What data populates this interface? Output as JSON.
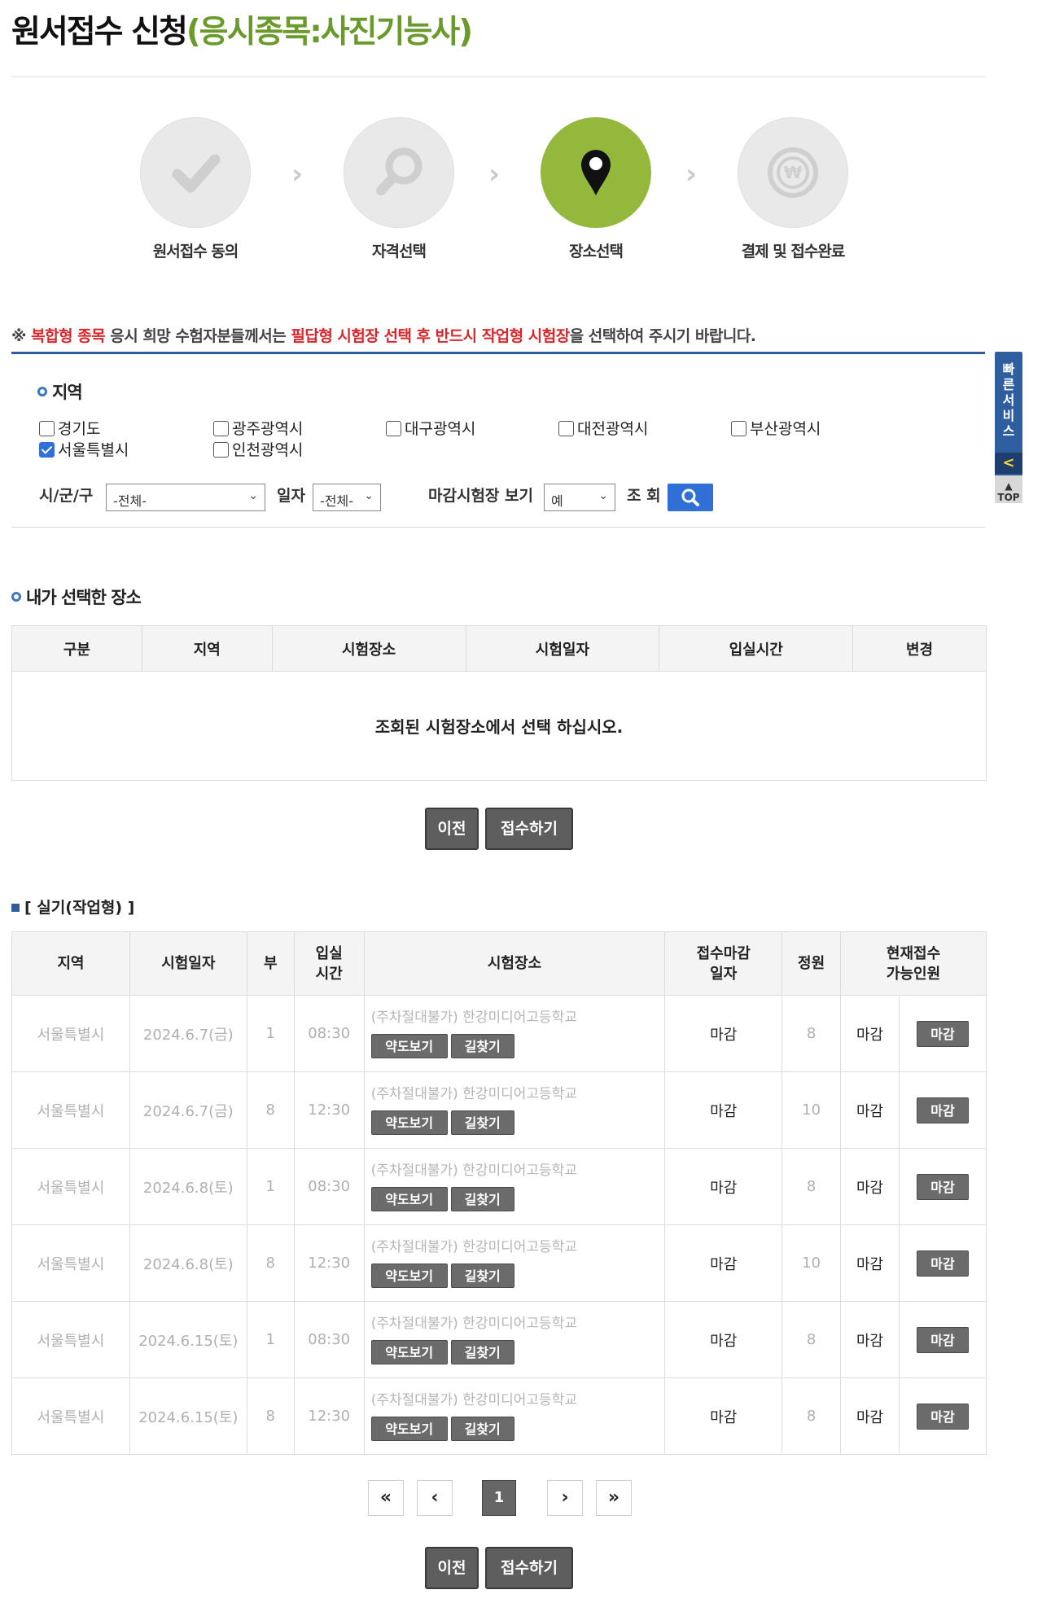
{
  "title": {
    "main": "원서접수 신청",
    "sub": "(응시종목:사진기능사)"
  },
  "steps": [
    {
      "label": "원서접수 동의",
      "icon": "check-icon",
      "active": false
    },
    {
      "label": "자격선택",
      "icon": "magnifier-icon",
      "active": false
    },
    {
      "label": "장소선택",
      "icon": "map-pin-icon",
      "active": true
    },
    {
      "label": "결제 및 접수완료",
      "icon": "won-coin-icon",
      "active": false
    }
  ],
  "notice": {
    "mark": "※",
    "red1": "복합형 종목",
    "text1": " 응시 희망 수험자분들께서는 ",
    "red2": "필답형 시험장 선택 후 반드시 작업형 시험장",
    "text2": "을 선택하여 주시기 바랍니다."
  },
  "region": {
    "title": "지역",
    "options": [
      {
        "label": "경기도",
        "checked": false
      },
      {
        "label": "광주광역시",
        "checked": false
      },
      {
        "label": "대구광역시",
        "checked": false
      },
      {
        "label": "대전광역시",
        "checked": false
      },
      {
        "label": "부산광역시",
        "checked": false
      },
      {
        "label": "서울특별시",
        "checked": true
      },
      {
        "label": "인천광역시",
        "checked": false
      }
    ]
  },
  "filters": {
    "city_label": "시/군/구",
    "city_value": "-전체-",
    "date_label": "일자",
    "date_value": "-전체-",
    "closed_label": "마감시험장 보기",
    "closed_value": "예",
    "search_label": "조 회"
  },
  "selected": {
    "title": "내가 선택한 장소",
    "headers": [
      "구분",
      "지역",
      "시험장소",
      "시험일자",
      "입실시간",
      "변경"
    ],
    "empty_message": "조회된 시험장소에서 선택 하십시오."
  },
  "buttons": {
    "prev": "이전",
    "submit": "접수하기"
  },
  "practical": {
    "title": "[ 실기(작업형) ]",
    "headers": {
      "region": "지역",
      "date": "시험일자",
      "part": "부",
      "entry_line1": "입실",
      "entry_line2": "시간",
      "place": "시험장소",
      "deadline_line1": "접수마감",
      "deadline_line2": "일자",
      "capacity": "정원",
      "available_line1": "현재접수",
      "available_line2": "가능인원"
    },
    "map_label": "약도보기",
    "route_label": "길찾기",
    "rows": [
      {
        "region": "서울특별시",
        "date": "2024.6.7(금)",
        "part": "1",
        "time": "08:30",
        "place": "(주차절대불가) 한강미디어고등학교",
        "deadline": "마감",
        "capacity": "8",
        "available": "마감",
        "action": "마감"
      },
      {
        "region": "서울특별시",
        "date": "2024.6.7(금)",
        "part": "8",
        "time": "12:30",
        "place": "(주차절대불가) 한강미디어고등학교",
        "deadline": "마감",
        "capacity": "10",
        "available": "마감",
        "action": "마감"
      },
      {
        "region": "서울특별시",
        "date": "2024.6.8(토)",
        "part": "1",
        "time": "08:30",
        "place": "(주차절대불가) 한강미디어고등학교",
        "deadline": "마감",
        "capacity": "8",
        "available": "마감",
        "action": "마감"
      },
      {
        "region": "서울특별시",
        "date": "2024.6.8(토)",
        "part": "8",
        "time": "12:30",
        "place": "(주차절대불가) 한강미디어고등학교",
        "deadline": "마감",
        "capacity": "10",
        "available": "마감",
        "action": "마감"
      },
      {
        "region": "서울특별시",
        "date": "2024.6.15(토)",
        "part": "1",
        "time": "08:30",
        "place": "(주차절대불가) 한강미디어고등학교",
        "deadline": "마감",
        "capacity": "8",
        "available": "마감",
        "action": "마감"
      },
      {
        "region": "서울특별시",
        "date": "2024.6.15(토)",
        "part": "8",
        "time": "12:30",
        "place": "(주차절대불가) 한강미디어고등학교",
        "deadline": "마감",
        "capacity": "8",
        "available": "마감",
        "action": "마감"
      }
    ]
  },
  "pagination": {
    "first": "«",
    "prev": "‹",
    "current": "1",
    "next": "›",
    "last": "»"
  },
  "side_menu": {
    "label": "빠른서비스",
    "back": "<",
    "top": "TOP"
  },
  "colors": {
    "accent_green": "#93b83b",
    "title_green": "#6a9a2c",
    "notice_red": "#d9262b",
    "nav_blue": "#2f5e9f"
  }
}
